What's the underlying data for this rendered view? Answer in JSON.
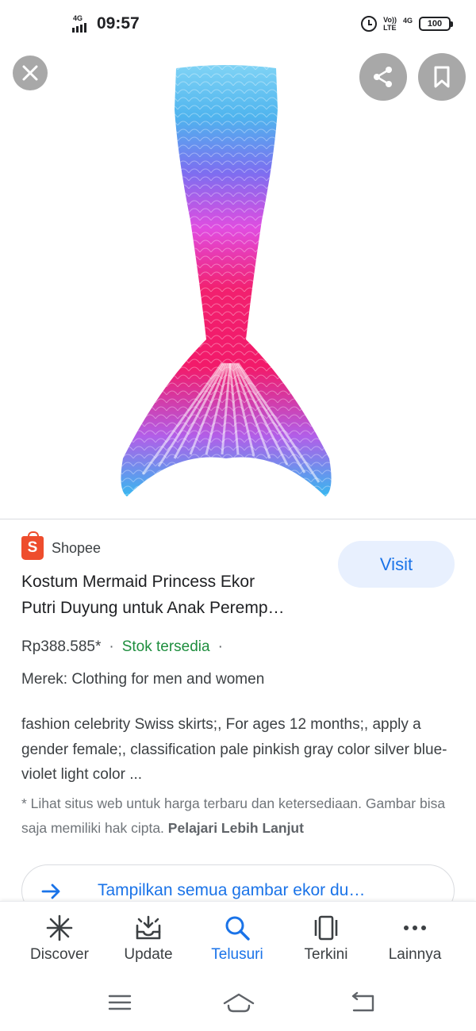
{
  "status_bar": {
    "network_small": "4G",
    "time": "09:57",
    "volte_top": "Vo))",
    "volte_bottom": "LTE",
    "network_right": "4G",
    "battery": "100"
  },
  "viewer": {
    "close_icon": "close-icon",
    "share_icon": "share-icon",
    "bookmark_icon": "bookmark-icon",
    "image_subject": "mermaid-tail-costume"
  },
  "result": {
    "source": "Shopee",
    "source_logo_letter": "S",
    "title_line1": "Kostum Mermaid Princess Ekor",
    "title_line2": "Putri Duyung untuk Anak Peremp…",
    "visit_label": "Visit",
    "price": "Rp388.585*",
    "separator": "·",
    "stock": "Stok tersedia",
    "brand": "Merek: Clothing for men and women",
    "description": "fashion celebrity Swiss skirts;, For ages 12 months;, apply a gender female;, classification pale pinkish gray color silver blue-violet light color ...",
    "disclaimer": "* Lihat situs web untuk harga terbaru dan ketersediaan. Gambar bisa saja memiliki hak cipta.",
    "learn_more": "Pelajari Lebih Lanjut",
    "show_all": "Tampilkan semua gambar ekor du…"
  },
  "bottom_nav": {
    "items": [
      {
        "label": "Discover",
        "icon": "asterisk-icon"
      },
      {
        "label": "Update",
        "icon": "inbox-icon"
      },
      {
        "label": "Telusuri",
        "icon": "search-icon",
        "active": true
      },
      {
        "label": "Terkini",
        "icon": "recent-cards-icon"
      },
      {
        "label": "Lainnya",
        "icon": "more-icon"
      }
    ]
  },
  "colors": {
    "accent": "#1a73e8",
    "stock_green": "#1e8e3e",
    "shopee_orange": "#ee4d2d",
    "visit_bg": "#e8f0fe"
  }
}
